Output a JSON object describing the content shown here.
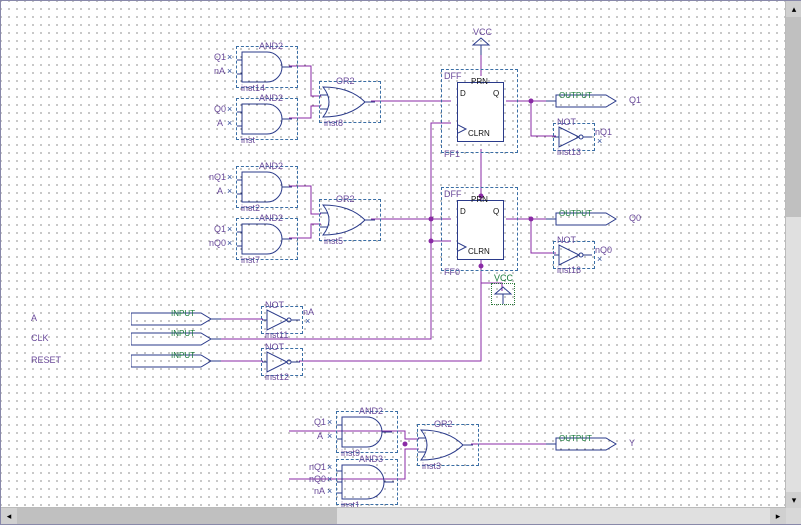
{
  "gates": {
    "and2_1": {
      "type": "AND2",
      "inst": "inst14",
      "in1": "Q1",
      "in2": "nA"
    },
    "and2_2": {
      "type": "AND2",
      "inst": "inst",
      "in1": "Q0",
      "in2": "A"
    },
    "and2_3": {
      "type": "AND2",
      "inst": "inst2",
      "in1": "nQ1",
      "in2": "A"
    },
    "and2_4": {
      "type": "AND2",
      "inst": "inst7",
      "in1": "Q1",
      "in2": "nQ0"
    },
    "and2_5": {
      "type": "AND2",
      "inst": "inst9",
      "in1": "Q1",
      "in2": "A"
    },
    "and3_1": {
      "type": "AND3",
      "inst": "inst1",
      "in1": "nQ1",
      "in2": "nQ0",
      "in3": "nA"
    },
    "or2_1": {
      "type": "OR2",
      "inst": "inst8"
    },
    "or2_2": {
      "type": "OR2",
      "inst": "inst5"
    },
    "or2_3": {
      "type": "OR2",
      "inst": "inst3"
    },
    "not_1": {
      "type": "NOT",
      "inst": "inst11",
      "out": "nA"
    },
    "not_2": {
      "type": "NOT",
      "inst": "inst12"
    },
    "not_3": {
      "type": "NOT",
      "inst": "inst13",
      "out": "nQ1"
    },
    "not_4": {
      "type": "NOT",
      "inst": "inst16",
      "out": "nQ0"
    }
  },
  "ffs": {
    "ff1": {
      "name": "FF1",
      "lib": "PRN",
      "d": "D",
      "q": "Q",
      "clr": "CLRN",
      "out": "Q1"
    },
    "ff0": {
      "name": "FF0",
      "lib": "PRN",
      "d": "D",
      "q": "Q",
      "clr": "CLRN",
      "out": "Q0"
    }
  },
  "io": {
    "input_label": "INPUT",
    "output_label": "OUTPUT",
    "vcc": "VCC",
    "dff": "DFF",
    "A": "A",
    "CLK": "CLK",
    "RESET": "RESET",
    "Q1": "Q1",
    "Q0": "Q0",
    "Y": "Y"
  },
  "signals": {
    "Q1": "Q1",
    "nQ1": "nQ1",
    "Q0": "Q0",
    "nQ0": "nQ0",
    "A": "A",
    "nA": "nA"
  }
}
